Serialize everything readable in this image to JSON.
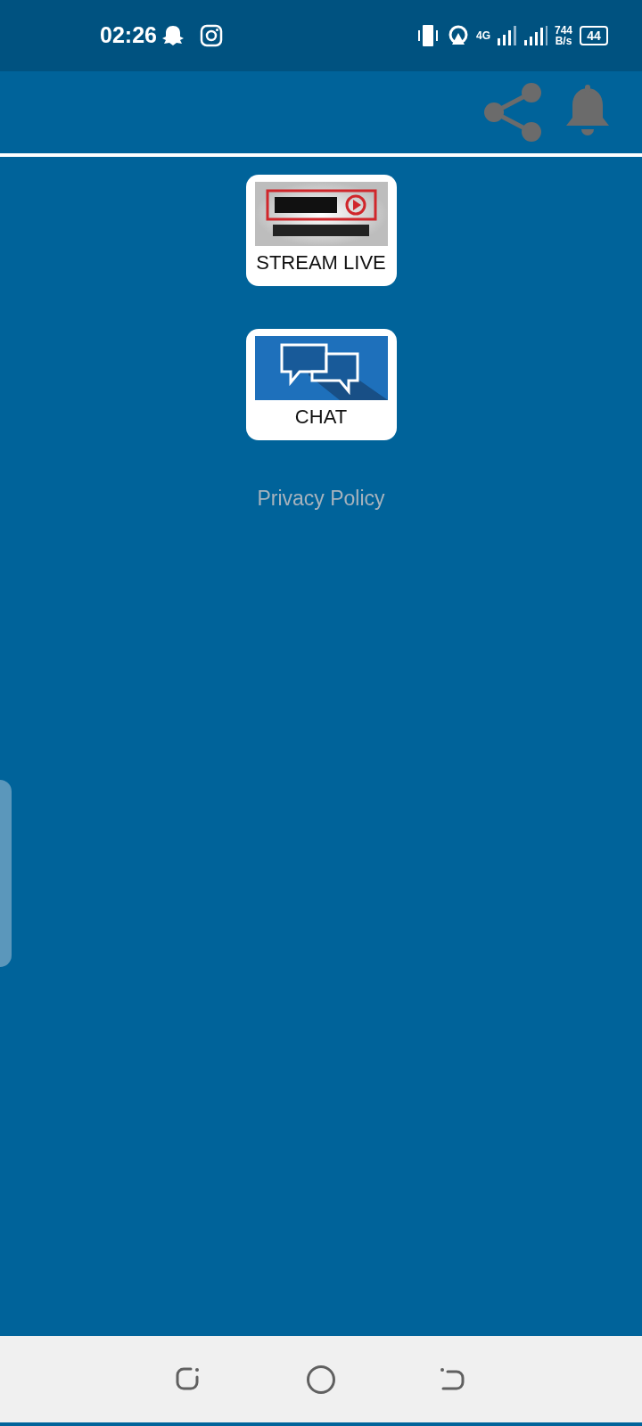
{
  "status_bar": {
    "time": "02:26",
    "network": "4G",
    "speed": "744",
    "speed_unit": "B/s",
    "battery": "44"
  },
  "tiles": [
    {
      "kind": "live",
      "label": "STREAM LIVE"
    },
    {
      "kind": "chat",
      "label": "CHAT"
    }
  ],
  "privacy_link": "Privacy Policy"
}
